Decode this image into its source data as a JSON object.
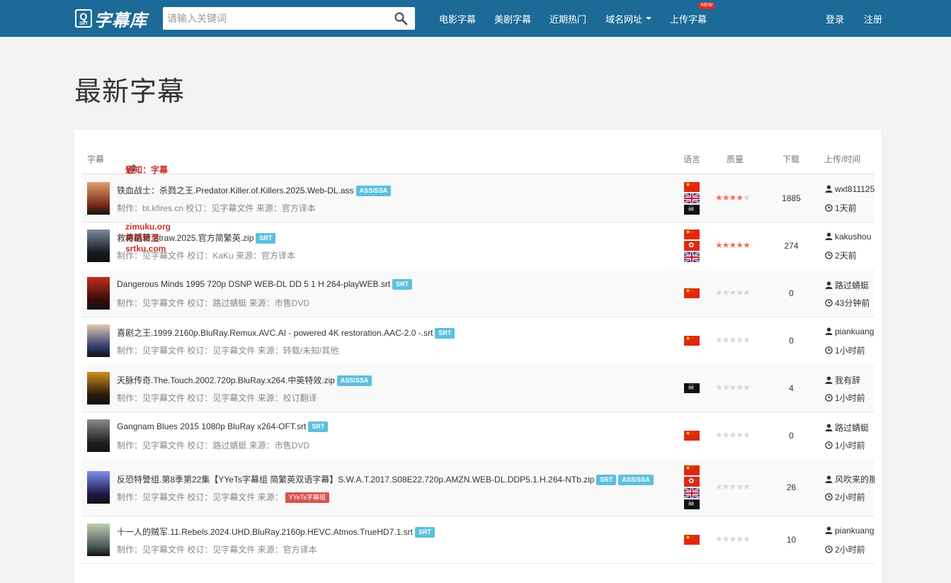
{
  "header": {
    "logo_letter": "Q",
    "logo_sub": "SRT",
    "logo_text": "字幕库",
    "search_placeholder": "请输入关键词",
    "nav": [
      {
        "label": "电影字幕"
      },
      {
        "label": "美剧字幕"
      },
      {
        "label": "近期热门"
      },
      {
        "label": "域名网址",
        "dropdown": true
      },
      {
        "label": "上传字幕",
        "badge": "NEW"
      }
    ],
    "login": "登录",
    "register": "注册",
    "bg_color": "#1c6a97"
  },
  "page_title": "最新字幕",
  "table": {
    "col_subtitle": "字幕",
    "notice": "通知：字幕库启用新域名：srtku.com,而zimuku.org将跳转至srtku.com",
    "col_lang": "语言",
    "col_quality": "质量",
    "col_downloads": "下载",
    "col_upload_time": "上传/时间",
    "rows": [
      {
        "title": "铁血战士：杀戮之王.Predator.Killer.of.Killers.2025.Web-DL.ass",
        "tags": [
          "ASS/SSA"
        ],
        "meta": "制作：bt.kfires.cn 校订：见字幕文件 来源：官方译本",
        "source_tag": "",
        "langs": [
          "cn",
          "uk",
          "pirate"
        ],
        "rating": 4,
        "downloads": "1885",
        "uploader": "wxt811125",
        "time": "1天前"
      },
      {
        "title": "救命稻草.Straw.2025.官方简繁英.zip",
        "tags": [
          "SRT"
        ],
        "meta": "制作：见字幕文件 校订：KaKu 来源：官方译本",
        "source_tag": "",
        "langs": [
          "cn",
          "hk",
          "uk"
        ],
        "rating": 5,
        "downloads": "274",
        "uploader": "kakushou",
        "time": "2天前"
      },
      {
        "title": "Dangerous Minds 1995 720p DSNP WEB-DL DD 5 1 H 264-playWEB.srt",
        "tags": [
          "SRT"
        ],
        "meta": "制作：见字幕文件 校订：路过蜻蜓 来源：市售DVD",
        "source_tag": "",
        "langs": [
          "cn"
        ],
        "rating": 0,
        "downloads": "0",
        "uploader": "路过蜻蜓",
        "time": "43分钟前"
      },
      {
        "title": "喜剧之王.1999.2160p.BluRay.Remux.AVC.AI - powered 4K restoration.AAC-2.0 -.srt",
        "tags": [
          "SRT"
        ],
        "meta": "制作：见字幕文件 校订：见字幕文件 来源：转载/未知/其他",
        "source_tag": "",
        "langs": [
          "cn"
        ],
        "rating": 0,
        "downloads": "0",
        "uploader": "piankuang",
        "time": "1小时前"
      },
      {
        "title": "天脉传奇.The.Touch.2002.720p.BluRay.x264.中英特效.zip",
        "tags": [
          "ASS/SSA"
        ],
        "meta": "制作：见字幕文件 校订：见字幕文件 来源：校订翻译",
        "source_tag": "",
        "langs": [
          "pirate"
        ],
        "rating": 0,
        "downloads": "4",
        "uploader": "我有辞",
        "time": "1小时前"
      },
      {
        "title": "Gangnam Blues 2015 1080p BluRay x264-OFT.srt",
        "tags": [
          "SRT"
        ],
        "meta": "制作：见字幕文件 校订：路过蜻蜓 来源：市售DVD",
        "source_tag": "",
        "langs": [
          "cn"
        ],
        "rating": 0,
        "downloads": "0",
        "uploader": "路过蜻蜓",
        "time": "1小时前"
      },
      {
        "title": "反恐特警组.第8季第22集【YYeTs字幕组 简繁英双语字幕】S.W.A.T.2017.S08E22.720p.AMZN.WEB-DL.DDP5.1.H.264-NTb.zip",
        "tags": [
          "SRT",
          "ASS/SSA"
        ],
        "meta": "制作：见字幕文件 校订：见字幕文件 来源：",
        "source_tag": "YYeTs字幕组",
        "langs": [
          "cn",
          "hk",
          "uk",
          "pirate"
        ],
        "rating": 0,
        "downloads": "26",
        "uploader": "风吹来的那",
        "time": "2小时前"
      },
      {
        "title": "十一人的贼军.11.Rebels.2024.UHD.BluRay.2160p.HEVC.Atmos.TrueHD7.1.srt",
        "tags": [
          "SRT"
        ],
        "meta": "制作：见字幕文件 校订：见字幕文件 来源：官方译本",
        "source_tag": "",
        "langs": [
          "cn"
        ],
        "rating": 0,
        "downloads": "10",
        "uploader": "piankuang",
        "time": "2小时前"
      }
    ]
  },
  "colors": {
    "tag": "#5bc0de",
    "notice": "#c9302c",
    "star_on": "#e8735a",
    "star_off": "#d8d8d8",
    "source_tag": "#d9534f"
  }
}
